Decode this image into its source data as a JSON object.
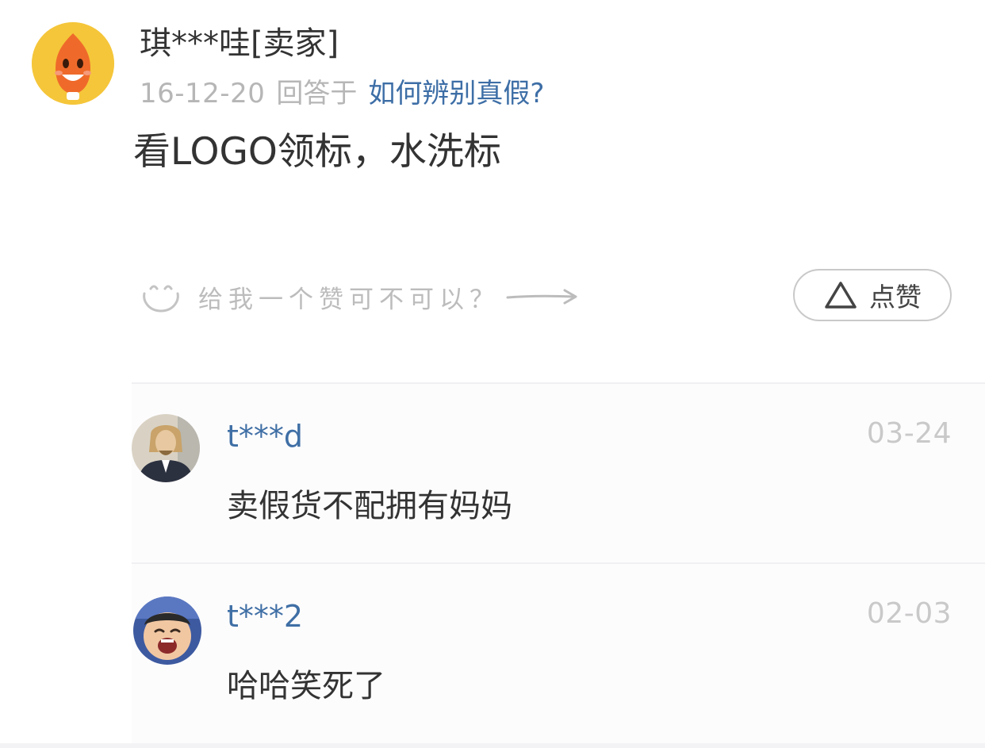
{
  "answer_post": {
    "author": "琪***哇[卖家]",
    "date": "16-12-20",
    "answered_label": "回答于",
    "question_link": "如何辨别真假?",
    "body": "看LOGO领标，水洗标",
    "like_prompt": "给我一个赞可不可以？",
    "like_button_label": "点赞",
    "avatar_icon": "orange-flame-mascot-icon"
  },
  "comments": [
    {
      "user": "t***d",
      "date": "03-24",
      "text": "卖假货不配拥有妈妈",
      "avatar_icon": "sketched-man-portrait-avatar"
    },
    {
      "user": "t***2",
      "date": "02-03",
      "text": "哈哈笑死了",
      "avatar_icon": "laughing-kid-photo-avatar"
    }
  ],
  "colors": {
    "link_blue": "#3d6ea6",
    "meta_gray": "#b6b6b6",
    "text_dark": "#333333",
    "divider": "#f0eff2"
  }
}
